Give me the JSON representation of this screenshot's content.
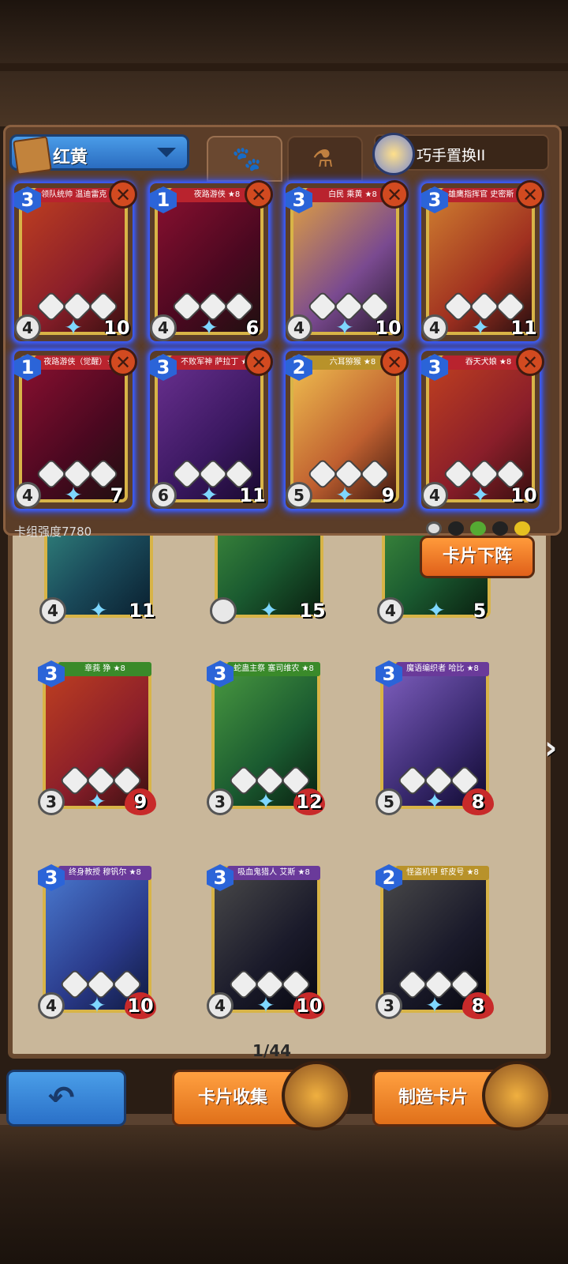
{
  "deck": {
    "name": "红黄",
    "skill_label": "巧手置换II",
    "power_label": "卡组强度7780"
  },
  "tabs": [
    {
      "icon": "paw-icon",
      "glyph": "🐾"
    },
    {
      "icon": "potion-icon",
      "glyph": "⚗"
    }
  ],
  "deck_cards": [
    {
      "cost": "3",
      "name": "领队统帅 温迪雷克 ★8",
      "atk": "4",
      "hp": "10",
      "bg": "bg-red",
      "banner": ""
    },
    {
      "cost": "1",
      "name": "夜路游侠 ★8",
      "atk": "4",
      "hp": "6",
      "bg": "bg-crimson",
      "banner": ""
    },
    {
      "cost": "3",
      "name": "白民 乘黄 ★8",
      "atk": "4",
      "hp": "10",
      "bg": "bg-amber",
      "banner": ""
    },
    {
      "cost": "3",
      "name": "雄鹰指挥官 史密斯 ★8",
      "atk": "4",
      "hp": "11",
      "bg": "bg-orange",
      "banner": ""
    },
    {
      "cost": "1",
      "name": "夜路游侠（觉醒）★8",
      "atk": "4",
      "hp": "7",
      "bg": "bg-crimson",
      "banner": ""
    },
    {
      "cost": "3",
      "name": "不败军神 萨拉丁 ★8",
      "atk": "6",
      "hp": "11",
      "bg": "bg-purple",
      "banner": ""
    },
    {
      "cost": "2",
      "name": "六耳猕猴 ★8",
      "atk": "5",
      "hp": "9",
      "bg": "bg-gold",
      "banner": "ban-gold"
    },
    {
      "cost": "3",
      "name": "吞天犬娘 ★8",
      "atk": "4",
      "hp": "10",
      "bg": "bg-red",
      "banner": ""
    }
  ],
  "partial_cards": [
    {
      "atk": "4",
      "hp": "11",
      "bg": "bg-teal"
    },
    {
      "atk": "",
      "hp": "15",
      "bg": "bg-green"
    },
    {
      "atk": "4",
      "hp": "5",
      "bg": "bg-green"
    }
  ],
  "collection_cards": [
    {
      "cost": "3",
      "name": "章莪 狰 ★8",
      "atk": "3",
      "hp": "9",
      "bg": "bg-red",
      "banner": "ban-green"
    },
    {
      "cost": "3",
      "name": "蛇蛊主祭 塞司维农 ★8",
      "atk": "3",
      "hp": "12",
      "bg": "bg-green",
      "banner": "ban-green"
    },
    {
      "cost": "3",
      "name": "魔语编织者 哈比 ★8",
      "atk": "5",
      "hp": "8",
      "bg": "bg-violet",
      "banner": "ban-purple"
    },
    {
      "cost": "3",
      "name": "终身教授 穆钒尔 ★8",
      "atk": "4",
      "hp": "10",
      "bg": "bg-blue",
      "banner": "ban-purple"
    },
    {
      "cost": "3",
      "name": "吸血鬼猎人 艾斯 ★8",
      "atk": "4",
      "hp": "10",
      "bg": "bg-dark",
      "banner": "ban-purple"
    },
    {
      "cost": "2",
      "name": "怪盗机甲 虾皮号 ★8",
      "atk": "3",
      "hp": "8",
      "bg": "bg-dark",
      "banner": "ban-gold"
    }
  ],
  "pager": "1/44",
  "buttons": {
    "unload": "卡片下阵",
    "collection": "卡片收集",
    "craft": "制造卡片"
  }
}
